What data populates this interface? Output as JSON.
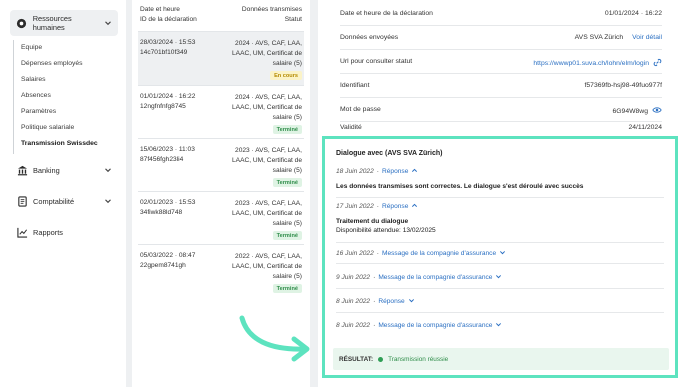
{
  "sidebar": {
    "groups": [
      {
        "label": "Ressources humaines",
        "icon": "users-gear-icon"
      },
      {
        "label": "Banking",
        "icon": "bank-icon"
      },
      {
        "label": "Comptabilité",
        "icon": "ledger-icon"
      },
      {
        "label": "Rapports",
        "icon": "chart-line-icon"
      }
    ],
    "sub_items": [
      "Equipe",
      "Dépenses employés",
      "Salaires",
      "Absences",
      "Paramètres",
      "Politique salariale",
      "Transmission Swissdec"
    ]
  },
  "list": {
    "head_left_1": "Date et heure",
    "head_left_2": "ID de la déclaration",
    "head_right_1": "Données transmises",
    "head_right_2": "Statut",
    "rows": [
      {
        "date": "28/03/2024 · 15:53",
        "id": "14c701bf10f349",
        "desc": "2024 · AVS, CAF, LAA, LAAC, UM, Certificat de salaire (5)",
        "status": "En cours"
      },
      {
        "date": "01/01/2024 · 16:22",
        "id": "12ngfnfnfg8745",
        "desc": "2024 · AVS, CAF, LAA, LAAC, UM, Certificat de salaire (5)",
        "status": "Terminé"
      },
      {
        "date": "15/06/2023 · 11:03",
        "id": "87f456fgh23li4",
        "desc": "2023 · AVS, CAF, LAA, LAAC, UM, Certificat de salaire (5)",
        "status": "Terminé"
      },
      {
        "date": "02/01/2023 · 15:53",
        "id": "34fiwk88ld748",
        "desc": "2023 · AVS, CAF, LAA, LAAC, UM, Certificat de salaire (5)",
        "status": "Terminé"
      },
      {
        "date": "05/03/2022 · 08:47",
        "id": "22gpem8741gh",
        "desc": "2022 · AVS, CAF, LAA, LAAC, UM, Certificat de salaire (5)",
        "status": "Terminé"
      }
    ]
  },
  "detail": {
    "fields": [
      {
        "key": "Date et heure de la déclaration",
        "value": "01/01/2024 · 16:22"
      },
      {
        "key": "Données envoyées",
        "value": "AVS SVA Zürich",
        "link": "Voir détail"
      },
      {
        "key": "Url pour consulter statut",
        "value": "https://wwwp01.suva.ch/lohn/elm/login",
        "icon": "link-icon"
      },
      {
        "key": "Identifiant",
        "value": "f57369fb-hsj98-49fuo977f"
      },
      {
        "key": "Mot de passe",
        "value": "6G94W8wg",
        "icon": "eye-icon"
      },
      {
        "key": "Validité",
        "value": "24/11/2024"
      }
    ]
  },
  "dialog": {
    "title": "Dialogue avec (AVS SVA Zürich)",
    "entries": [
      {
        "date": "18 Juin 2022",
        "label": "Réponse",
        "body": "Les données transmises sont correctes. Le dialogue s'est déroulé avec succès"
      },
      {
        "date": "17 Juin 2022",
        "label": "Réponse",
        "body": "Traitement du dialogue",
        "sub": "Disponibilité attendue: 13/02/2025"
      },
      {
        "date": "16 Juin 2022",
        "label": "Message de la compagnie d'assurance"
      },
      {
        "date": "9 Juin 2022",
        "label": "Message de la compagnie d'assurance"
      },
      {
        "date": "8 Juin 2022",
        "label": "Réponse"
      },
      {
        "date": "8 Juin 2022",
        "label": "Message de la compagnie d'assurance"
      }
    ],
    "result_label": "RÉSULTAT:",
    "result_value": "Transmission réussie"
  },
  "colors": {
    "highlight": "#5de3bf",
    "link": "#2a6fc2",
    "success": "#2f8d4a",
    "pending": "#b58a00"
  }
}
